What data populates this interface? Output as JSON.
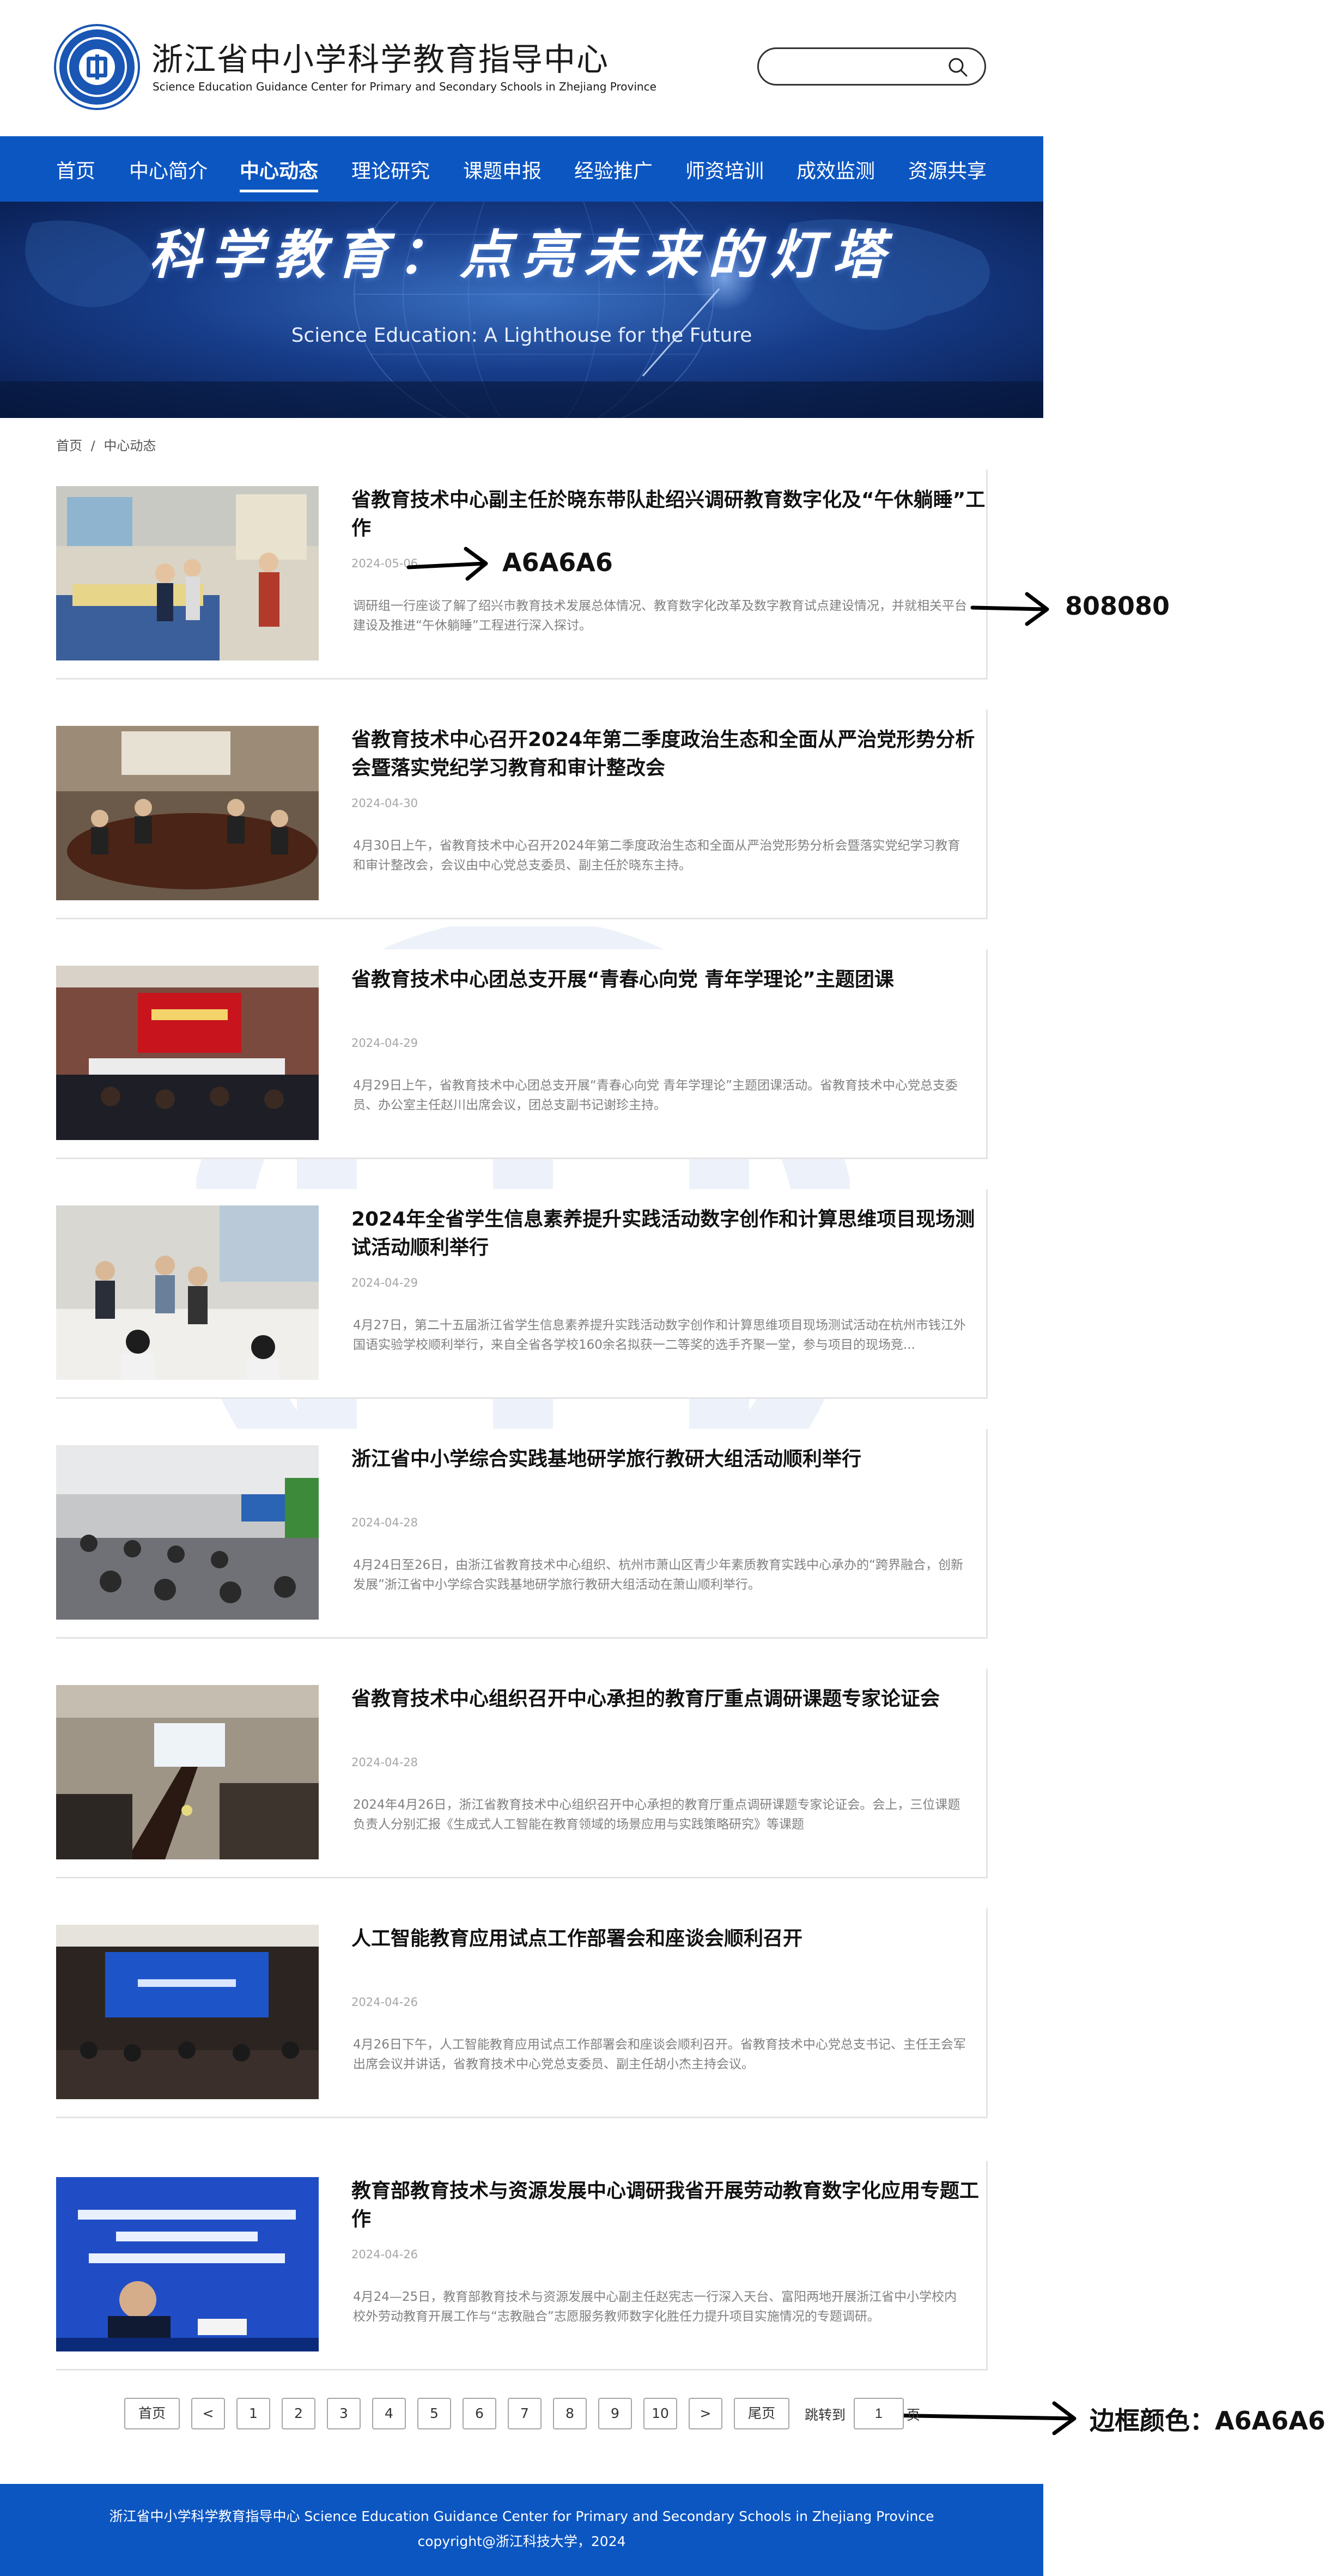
{
  "header": {
    "title": "浙江省中小学科学教育指导中心",
    "subtitle": "Science Education Guidance Center for Primary and Secondary Schools in Zhejiang Province",
    "search": {
      "placeholder": "",
      "icon": "search-icon"
    }
  },
  "nav": {
    "items": [
      {
        "label": "首页"
      },
      {
        "label": "中心简介"
      },
      {
        "label": "中心动态",
        "active": true
      },
      {
        "label": "理论研究"
      },
      {
        "label": "课题申报"
      },
      {
        "label": "经验推广"
      },
      {
        "label": "师资培训"
      },
      {
        "label": "成效监测"
      },
      {
        "label": "资源共享"
      }
    ]
  },
  "banner": {
    "title": "科学教育：点亮未来的灯塔",
    "subtitle": "Science Education: A Lighthouse for the Future"
  },
  "breadcrumb": {
    "home": "首页",
    "separator": "/",
    "current": "中心动态"
  },
  "articles": [
    {
      "title": "省教育技术中心副主任於晓东带队赴绍兴调研教育数字化及“午休躺睡”工作",
      "date": "2024-05-06",
      "summary": "调研组一行座谈了解了绍兴市教育技术发展总体情况、教育数字化改革及数字教育试点建设情况，并就相关平台建设及推进“午休躺睡”工程进行深入探讨。"
    },
    {
      "title": "省教育技术中心召开2024年第二季度政治生态和全面从严治党形势分析会暨落实党纪学习教育和审计整改会",
      "date": "2024-04-30",
      "summary": "4月30日上午，省教育技术中心召开2024年第二季度政治生态和全面从严治党形势分析会暨落实党纪学习教育和审计整改会，会议由中心党总支委员、副主任於晓东主持。"
    },
    {
      "title": "省教育技术中心团总支开展“青春心向党 青年学理论”主题团课",
      "date": "2024-04-29",
      "summary": "4月29日上午，省教育技术中心团总支开展“青春心向党 青年学理论”主题团课活动。省教育技术中心党总支委员、办公室主任赵川出席会议，团总支副书记谢珍主持。"
    },
    {
      "title": "2024年全省学生信息素养提升实践活动数字创作和计算思维项目现场测试活动顺利举行",
      "date": "2024-04-29",
      "summary": "4月27日，第二十五届浙江省学生信息素养提升实践活动数字创作和计算思维项目现场测试活动在杭州市钱江外国语实验学校顺利举行，来自全省各学校160余名拟获一二等奖的选手齐聚一堂，参与项目的现场竞..."
    },
    {
      "title": "浙江省中小学综合实践基地研学旅行教研大组活动顺利举行",
      "date": "2024-04-28",
      "summary": "4月24日至26日，由浙江省教育技术中心组织、杭州市萧山区青少年素质教育实践中心承办的“跨界融合，创新发展”浙江省中小学综合实践基地研学旅行教研大组活动在萧山顺利举行。"
    },
    {
      "title": "省教育技术中心组织召开中心承担的教育厅重点调研课题专家论证会",
      "date": "2024-04-28",
      "summary": "2024年4月26日，浙江省教育技术中心组织召开中心承担的教育厅重点调研课题专家论证会。会上，三位课题负责人分别汇报《生成式人工智能在教育领域的场景应用与实践策略研究》等课题"
    },
    {
      "title": "人工智能教育应用试点工作部署会和座谈会顺利召开",
      "date": "2024-04-26",
      "summary": "4月26日下午，人工智能教育应用试点工作部署会和座谈会顺利召开。省教育技术中心党总支书记、主任王会军出席会议并讲话，省教育技术中心党总支委员、副主任胡小杰主持会议。"
    },
    {
      "title": "教育部教育技术与资源发展中心调研我省开展劳动教育数字化应用专题工作",
      "date": "2024-04-26",
      "summary": "4月24—25日，教育部教育技术与资源发展中心副主任赵宪志一行深入天台、富阳两地开展浙江省中小学校内校外劳动教育开展工作与“志教融合”志愿服务教师数字化胜任力提升项目实施情况的专题调研。"
    }
  ],
  "annotations": {
    "date_color": "A6A6A6",
    "summary_color": "808080",
    "border_color": "边框颜色：A6A6A6"
  },
  "pagination": {
    "first": "首页",
    "prev": "<",
    "pages": [
      "1",
      "2",
      "3",
      "4",
      "5",
      "6",
      "7",
      "8",
      "9",
      "10"
    ],
    "next": ">",
    "last": "尾页",
    "jump_label": "跳转到",
    "jump_value": "1",
    "page_suffix": "页"
  },
  "footer": {
    "line1": "浙江省中小学科学教育指导中心  Science Education Guidance Center for Primary and Secondary Schools in Zhejiang Province",
    "line2": "copyright@浙江科技大学，2024"
  },
  "colors": {
    "brand_blue": "#0c56c2",
    "date_gray": "#a6a6a6",
    "summary_gray": "#808080",
    "border_gray": "#a6a6a6"
  }
}
